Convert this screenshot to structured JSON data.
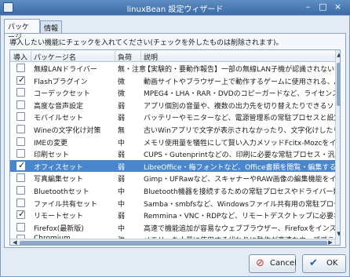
{
  "window": {
    "title": "linuxBean 設定ウィザード"
  },
  "tabs": [
    {
      "label": "パッケージ",
      "active": true
    },
    {
      "label": "情報",
      "active": false
    }
  ],
  "intro_text": "導入したい機能にチェックを入れてください(チェックを外したものは削除されます)。",
  "columns": [
    "導入",
    "パッケージ名",
    "負荷",
    "説明"
  ],
  "rows": [
    {
      "checked": false,
      "name": "無線LANドライバー",
      "load": "無・注意",
      "desc": "【実験的・要動作報告】一部の無線LAN子機が認識されない問題"
    },
    {
      "checked": true,
      "name": "Flashプラグイン",
      "load": "微",
      "desc": "動画サイトやブラウザー上で動作するゲームに使用される、Adob"
    },
    {
      "checked": false,
      "name": "コーデックセット",
      "load": "微",
      "desc": "MPEG4・LHA・RAR・DVDのコピーガードなど、ライセンスの関係"
    },
    {
      "checked": false,
      "name": "高度な音声設定",
      "load": "弱",
      "desc": "アプリ個別の音量や、複数の出力先を切り替えたりできるソフトウ"
    },
    {
      "checked": false,
      "name": "モバイルセット",
      "load": "弱",
      "desc": "バッテリーやモニターなど、電源管理系の常駐プロセスと設定ア"
    },
    {
      "checked": false,
      "name": "Wineの文字化け対策",
      "load": "無",
      "desc": "古いWinアプリで文字が表示されなかったり、文字化けしたりする"
    },
    {
      "checked": false,
      "name": "IMEの変更",
      "load": "中",
      "desc": "メモリ使用量を犠牲にして賢い入力メソッドFcitx-Mozcをインスト"
    },
    {
      "checked": false,
      "name": "印刷セット",
      "load": "弱",
      "desc": "CUPS・Gutenprintなどの、印刷に必要な常駐プロセス・汎用ド"
    },
    {
      "checked": true,
      "name": "オフィスセット",
      "load": "弱",
      "desc": "LibreOffice・梅フォントなど、Office書類を閲覧・編集するために",
      "selected": true
    },
    {
      "checked": false,
      "name": "写真編集セット",
      "load": "弱",
      "desc": "Gimp・UFRawなど、スキャナーやRAW画像の編集機能をインスト"
    },
    {
      "checked": false,
      "name": "Bluetoothセット",
      "load": "中",
      "desc": "Bluetooth機器を接続するための常駐プロセスやドライバー類を"
    },
    {
      "checked": false,
      "name": "ファイル共有セット",
      "load": "中",
      "desc": "Samba・smbfsなど、Windowsファイル共有用の常駐プロセスと"
    },
    {
      "checked": true,
      "name": "リモートセット",
      "load": "弱",
      "desc": "Remmina・VNC・RDPなど、リモートデスクトップに必要なライブラ"
    },
    {
      "checked": false,
      "name": "Firefox(最新版)",
      "load": "中",
      "desc": "高速で機能追加が容易なウェブブラウザー、Firefoxをインストー"
    },
    {
      "checked": false,
      "name": "Chromium",
      "load": "強",
      "desc": "メモリーを大量に使用する代わりに動作が高速なウェブブラウザ"
    }
  ],
  "buttons": {
    "cancel": "Cancel",
    "ok": "OK"
  }
}
